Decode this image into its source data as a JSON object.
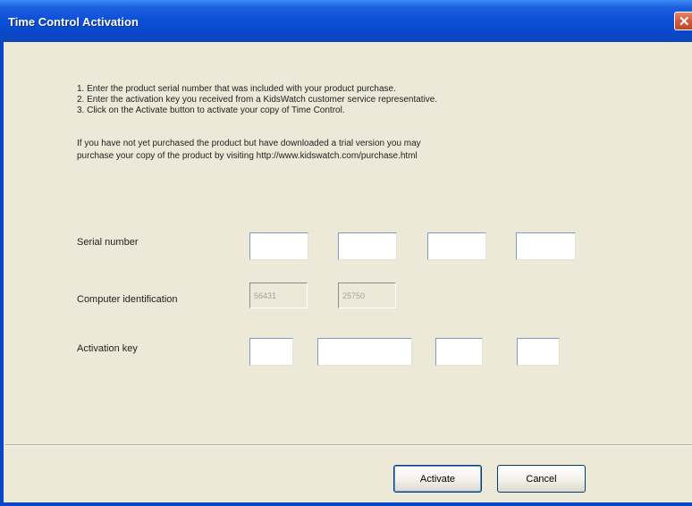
{
  "window": {
    "title": "Time Control Activation"
  },
  "instructions": [
    "1. Enter the product serial number that was included with your product purchase.",
    "2. Enter the activation key you received from a KidsWatch customer service representative.",
    "3. Click on the Activate button to activate your copy of Time Control."
  ],
  "note": [
    "If you have not yet purchased the product but have downloaded a trial version you may",
    "purchase your copy of the product by visiting http://www.kidswatch.com/purchase.html"
  ],
  "form": {
    "serial_label": "Serial number",
    "serial_values": [
      "",
      "",
      "",
      ""
    ],
    "computer_label": "Computer identification",
    "computer_values": [
      "56431",
      "25750"
    ],
    "activation_label": "Activation key",
    "activation_values": [
      "",
      "",
      "",
      ""
    ]
  },
  "buttons": {
    "activate": "Activate",
    "cancel": "Cancel"
  },
  "colors": {
    "titlebar": "#0a47c8",
    "face": "#ece9d8",
    "close": "#d35a3b"
  }
}
